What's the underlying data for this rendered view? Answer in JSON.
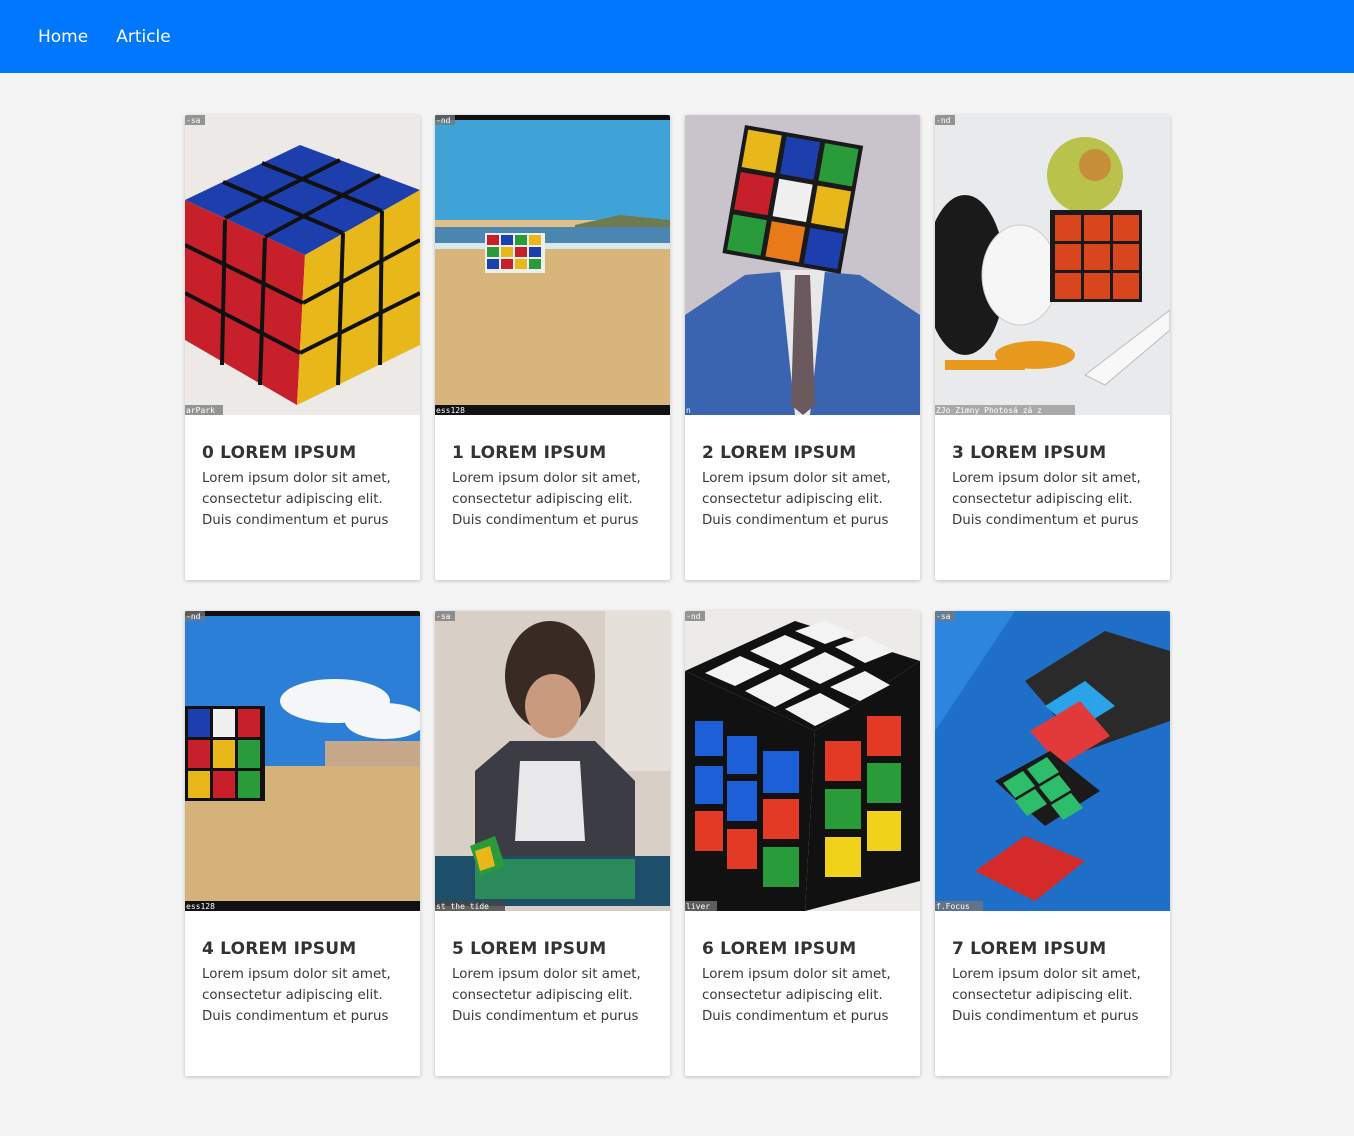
{
  "nav": {
    "items": [
      {
        "label": "Home"
      },
      {
        "label": "Article"
      }
    ],
    "background": "#0077ff"
  },
  "cards": [
    {
      "title": "0 LOREM IPSUM",
      "line1": "Lorem ipsum dolor sit amet,",
      "line2": "consectetur adipiscing elit.",
      "line3": "Duis condimentum et purus",
      "image": "rubiks-cube-closeup",
      "tag": "-sa",
      "credit": "arPark"
    },
    {
      "title": "1 LOREM IPSUM",
      "line1": "Lorem ipsum dolor sit amet,",
      "line2": "consectetur adipiscing elit.",
      "line3": "Duis condimentum et purus",
      "image": "cube-on-beach",
      "tag": "-nd",
      "credit": "ess128"
    },
    {
      "title": "2 LOREM IPSUM",
      "line1": "Lorem ipsum dolor sit amet,",
      "line2": "consectetur adipiscing elit.",
      "line3": "Duis condimentum et purus",
      "image": "cube-head-man-suit",
      "tag": "",
      "credit": "n"
    },
    {
      "title": "3 LOREM IPSUM",
      "line1": "Lorem ipsum dolor sit amet,",
      "line2": "consectetur adipiscing elit.",
      "line3": "Duis condimentum et purus",
      "image": "cube-with-apple-teapot",
      "tag": "-nd",
      "credit": "ZJo Zimny Photosá zá z"
    },
    {
      "title": "4 LOREM IPSUM",
      "line1": "Lorem ipsum dolor sit amet,",
      "line2": "consectetur adipiscing elit.",
      "line3": "Duis condimentum et purus",
      "image": "cube-on-sand-sky",
      "tag": "-nd",
      "credit": "ess128"
    },
    {
      "title": "5 LOREM IPSUM",
      "line1": "Lorem ipsum dolor sit amet,",
      "line2": "consectetur adipiscing elit.",
      "line3": "Duis condimentum et purus",
      "image": "boy-solving-cube",
      "tag": "-sa",
      "credit": "st the tide"
    },
    {
      "title": "6 LOREM IPSUM",
      "line1": "Lorem ipsum dolor sit amet,",
      "line2": "consectetur adipiscing elit.",
      "line3": "Duis condimentum et purus",
      "image": "black-cube-closeup",
      "tag": "-nd",
      "credit": "liver"
    },
    {
      "title": "7 LOREM IPSUM",
      "line1": "Lorem ipsum dolor sit amet,",
      "line2": "consectetur adipiscing elit.",
      "line3": "Duis condimentum et purus",
      "image": "stacked-puzzles",
      "tag": "-sa",
      "credit": "f.Focus"
    }
  ]
}
